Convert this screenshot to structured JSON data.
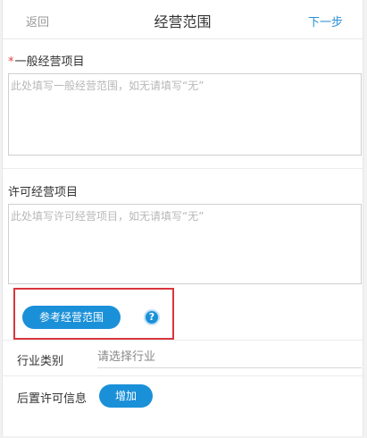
{
  "navbar": {
    "back_label": "返回",
    "title": "经营范围",
    "next_label": "下一步"
  },
  "general_scope": {
    "required_mark": "*",
    "label": "一般经营项目",
    "placeholder": "此处填写一般经营范围，如无请填写“无”"
  },
  "licensed_scope": {
    "label": "许可经营项目",
    "placeholder": "此处填写许可经营项目，如无请填写“无”"
  },
  "reference": {
    "button_label": "参考经营范围",
    "help_icon": "question-mark-icon",
    "help_glyph": "?"
  },
  "industry": {
    "label": "行业类别",
    "placeholder": "请选择行业"
  },
  "post_permit": {
    "label": "后置许可信息",
    "add_label": "增加"
  },
  "colors": {
    "accent": "#1a90d8",
    "link": "#2a8fd8",
    "highlight": "#d9363e",
    "required": "#e0443a"
  }
}
